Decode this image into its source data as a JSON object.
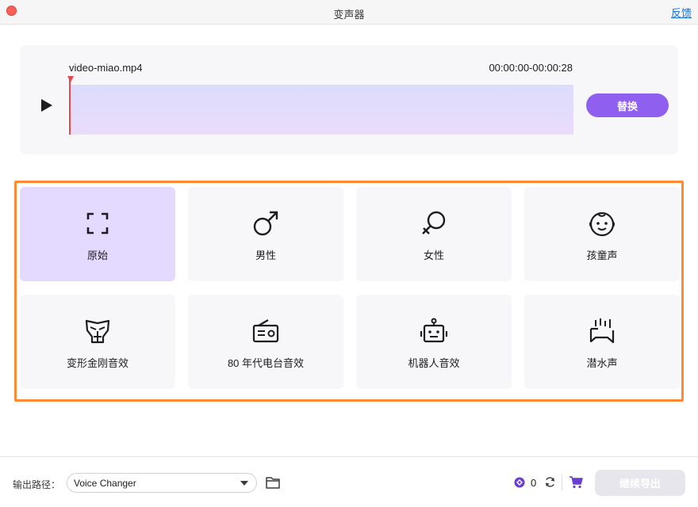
{
  "window": {
    "title": "变声器",
    "feedback_label": "反馈"
  },
  "player": {
    "filename": "video-miao.mp4",
    "timecode": "00:00:00-00:00:28",
    "replace_label": "替换",
    "icons": {
      "play": "play-icon"
    },
    "colors": {
      "accent": "#8f5ff0",
      "playhead": "#e8474d"
    }
  },
  "effects": {
    "selected": "原始",
    "items": [
      {
        "label": "原始",
        "icon": "original-frame-icon"
      },
      {
        "label": "男性",
        "icon": "male-symbol-icon"
      },
      {
        "label": "女性",
        "icon": "female-symbol-icon"
      },
      {
        "label": "孩童声",
        "icon": "child-face-icon"
      },
      {
        "label": "变形金刚音效",
        "icon": "transformer-mask-icon"
      },
      {
        "label": "80 年代电台音效",
        "icon": "radio-icon"
      },
      {
        "label": "机器人音效",
        "icon": "robot-icon"
      },
      {
        "label": "潜水声",
        "icon": "underwater-icon"
      }
    ],
    "colors": {
      "highlight_border": "#ff8a33",
      "selected_bg": "#e4daff"
    }
  },
  "footer": {
    "output_label": "输出路径：",
    "output_value": "Voice Changer",
    "credits": "0",
    "export_label": "继续导出",
    "icons": {
      "folder": "folder-icon",
      "credit": "credit-icon",
      "refresh": "refresh-icon",
      "cart": "cart-icon",
      "dropdown": "chevron-down-icon"
    }
  }
}
